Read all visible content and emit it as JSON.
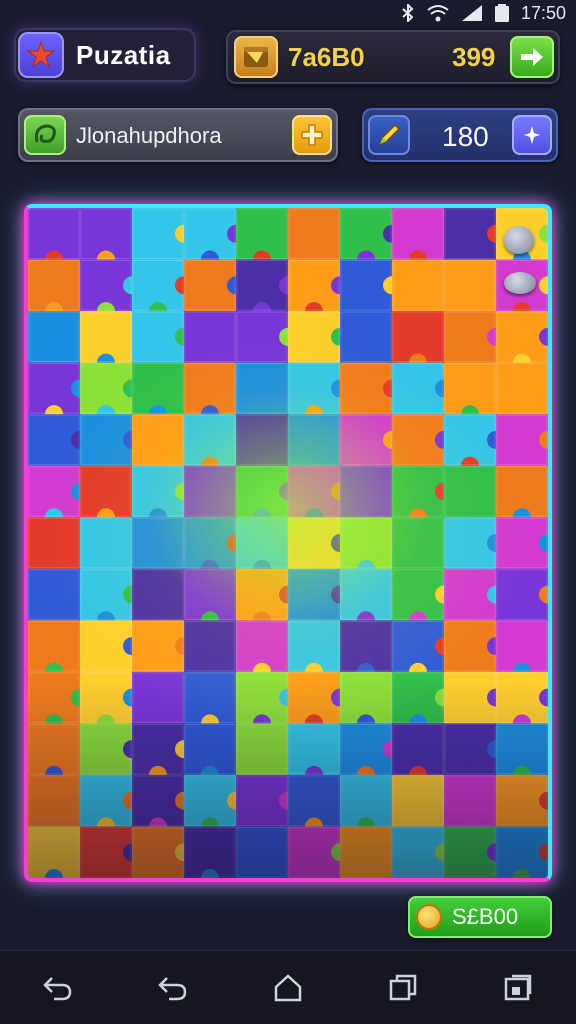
{
  "status": {
    "time": "17:50"
  },
  "header": {
    "title": "Puzatia",
    "coins_label": "7a6B0",
    "coins_value": "399"
  },
  "level": {
    "name": "Jlonahupdhora"
  },
  "moves": {
    "value": "180"
  },
  "footer": {
    "score_label": "S£B00"
  },
  "colors": {
    "accent_pink": "#ff3bd6",
    "accent_cyan": "#41e6ff",
    "coin_yellow": "#f3d24a",
    "go_green": "#43d23a"
  },
  "icons": {
    "app": "starfish-icon",
    "coin_pack": "treasure-box-icon",
    "go": "arrow-right-icon",
    "level": "leaf-icon",
    "add": "plus-icon",
    "pencil": "pencil-icon",
    "hint": "sparkle-icon",
    "nav": [
      "back-icon",
      "undo-icon",
      "home-icon",
      "recents-icon",
      "menu-icon"
    ]
  }
}
